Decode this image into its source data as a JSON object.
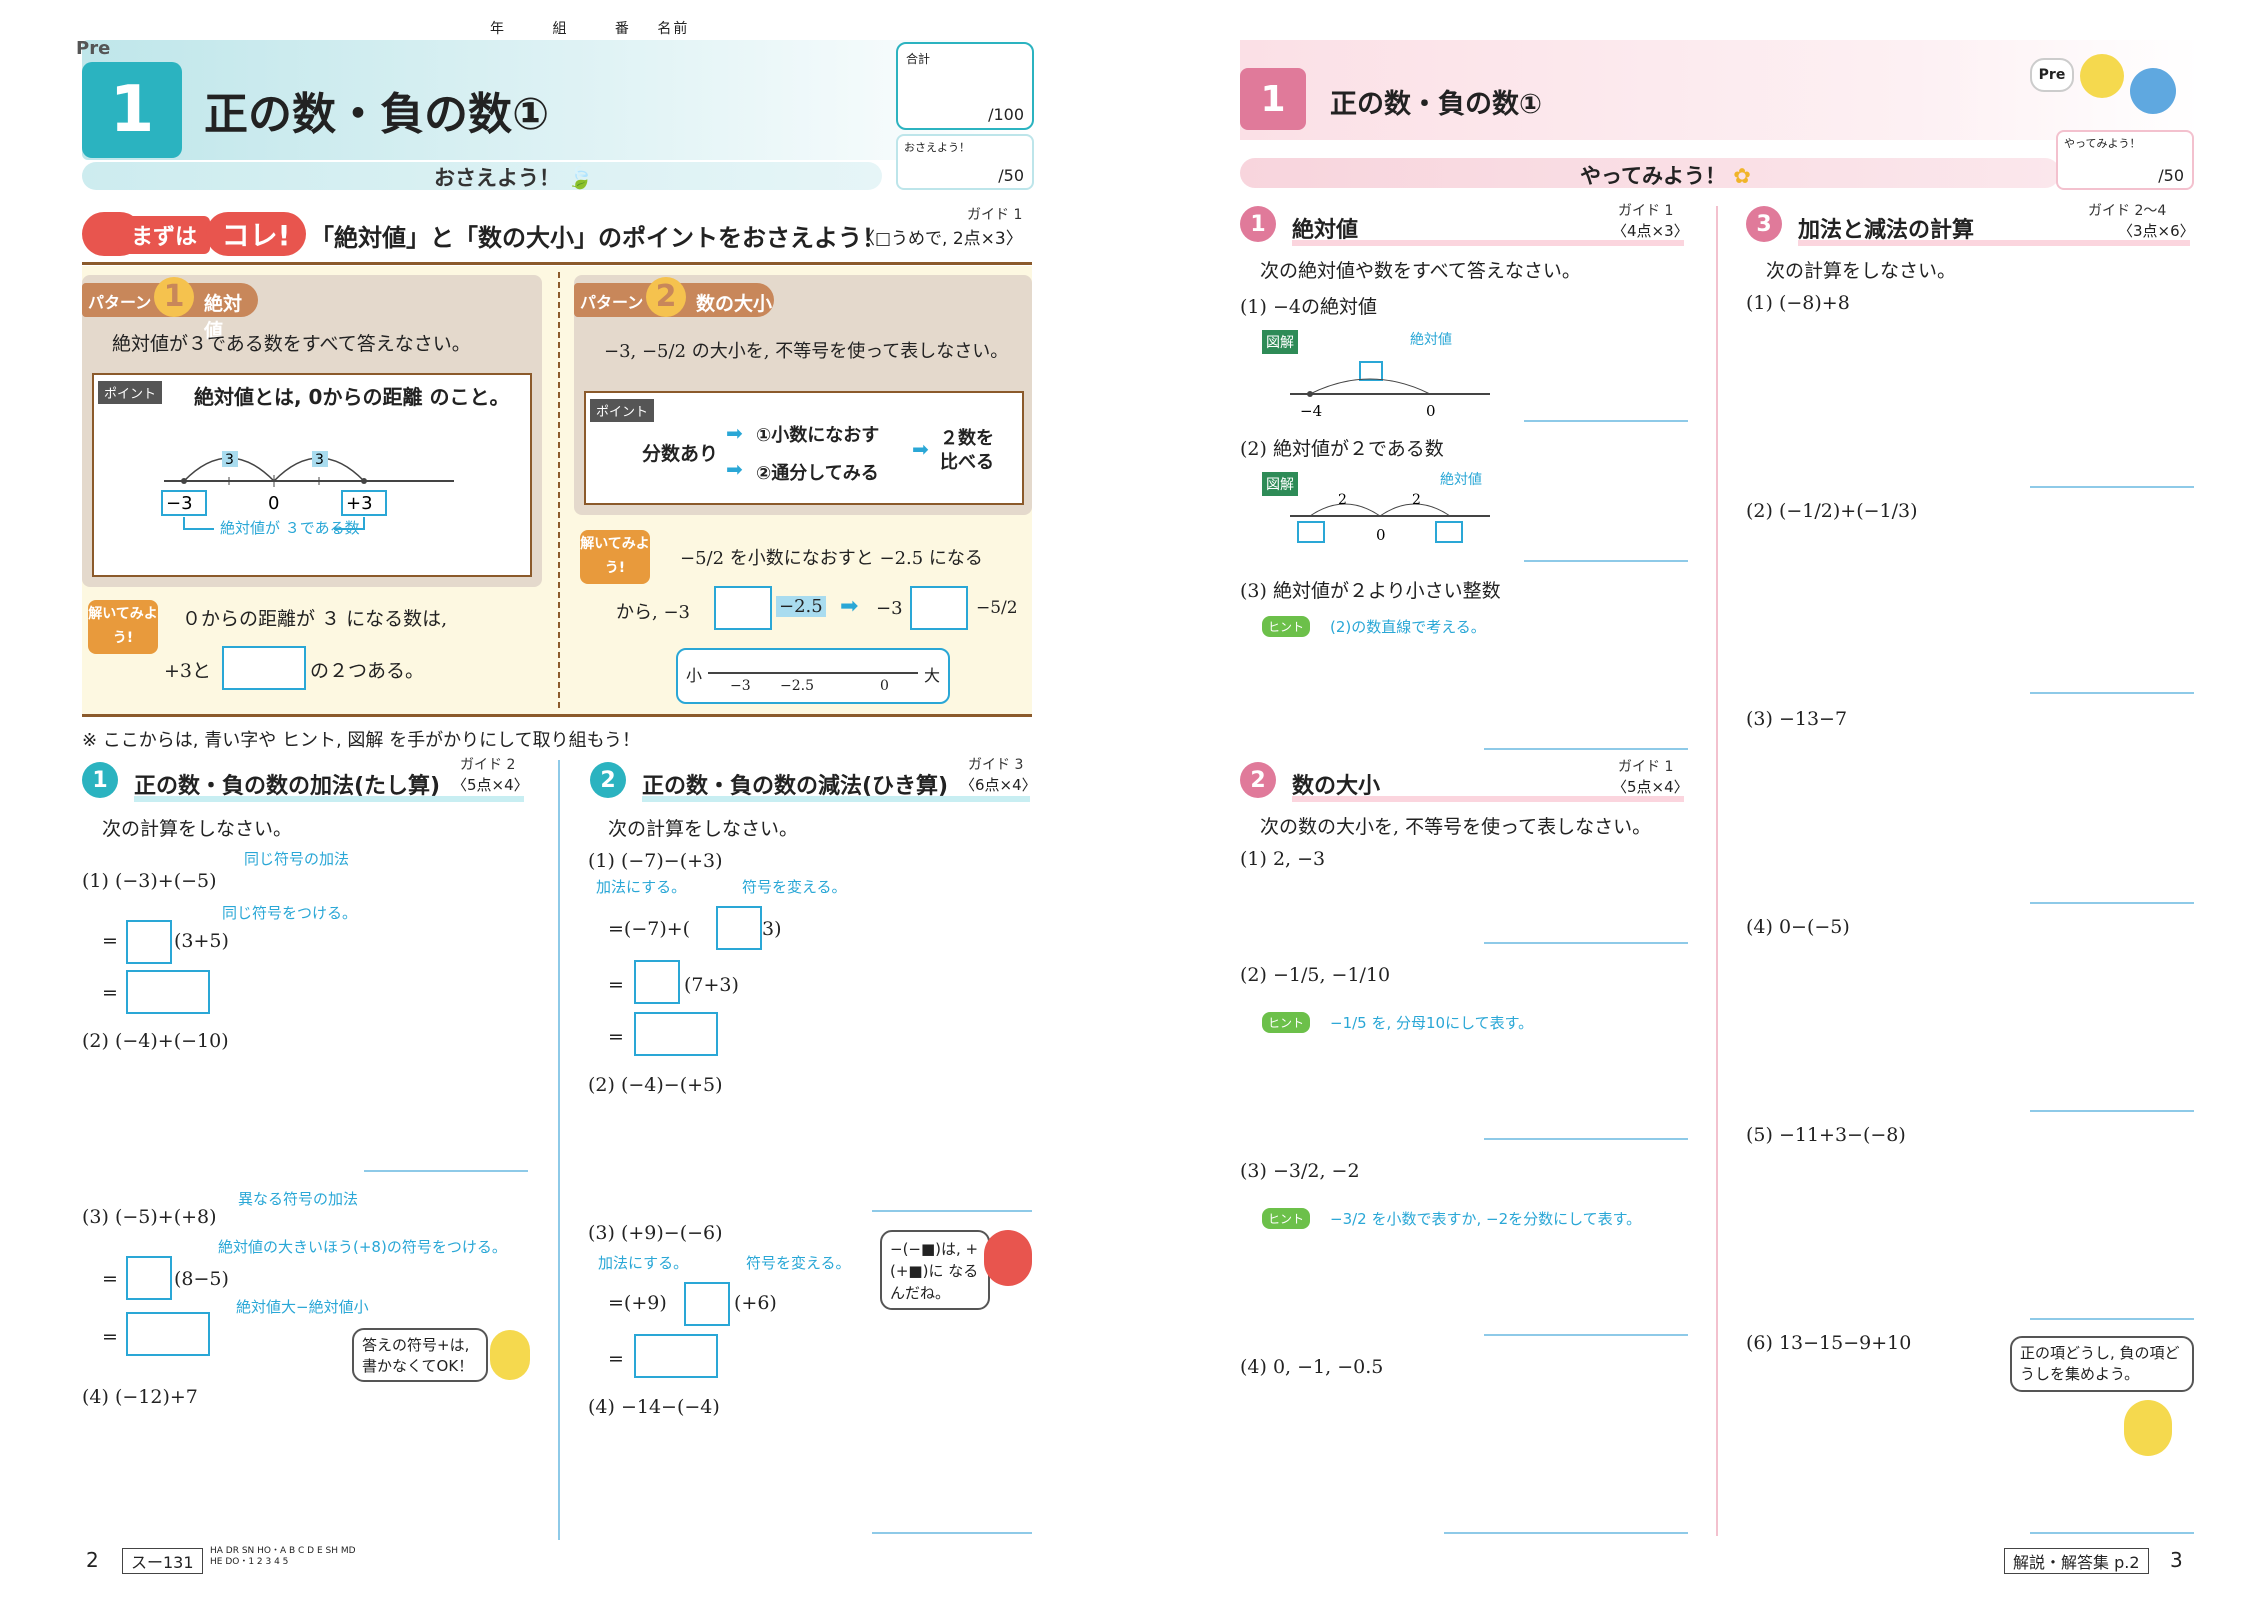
{
  "left": {
    "header": {
      "pre": "Pre",
      "name_fields": [
        "年",
        "組",
        "番",
        "名前"
      ],
      "unit_number": "1",
      "title": "正の数・負の数①",
      "osaeyou": "おさえよう！",
      "score_total_label": "合計",
      "score_total": "/100",
      "score_osae_label": "おさえよう！",
      "score_osae": "/50"
    },
    "mazu": {
      "badge": "まずは",
      "kore": "コレ!",
      "text": "「絶対値」と「数の大小」のポイントをおさえよう！",
      "note": "〈□うめで, 2点×3〉",
      "guide": "ガイド 1"
    },
    "pattern1": {
      "label": "パターン",
      "num": "1",
      "title": "絶対値",
      "question": "絶対値が３である数をすべて答えなさい。",
      "point_label": "ポイント",
      "point_text": "絶対値とは, 0からの距離 のこと。",
      "diagram": {
        "left": "−3",
        "zero": "0",
        "right": "+3",
        "arc": "3",
        "caption": "絶対値が ３である数"
      },
      "toite_label": "解いてみよう!",
      "line1": "０からの距離が ３ になる数は,",
      "line2a": "+3と",
      "line2b": "の２つある。"
    },
    "pattern2": {
      "label": "パターン",
      "num": "2",
      "title": "数の大小",
      "question": "−3, −5/2 の大小を, 不等号を使って表しなさい。",
      "point_label": "ポイント",
      "bunsu": "分数あり",
      "opt1": "①小数になおす",
      "opt2": "②通分してみる",
      "result": "２数を比べる",
      "toite_label": "解いてみよう!",
      "line1": "−5/2 を小数になおすと −2.5 になる",
      "line2a": "から, −3",
      "line2b": "−2.5",
      "line2c": "−3",
      "line2d": "−5/2",
      "numline": {
        "small": "小",
        "big": "大",
        "a": "−3",
        "b": "−2.5",
        "c": "0"
      }
    },
    "note": "※ ここからは, 青い字や ヒント, 図解 を手がかりにして取り組もう！",
    "sec1": {
      "num": "1",
      "title": "正の数・負の数の加法(たし算)",
      "points": "〈5点×4〉",
      "guide": "ガイド 2",
      "instruction": "次の計算をしなさい。",
      "q1": "(1)  (−3)+(−5)",
      "q1_note1": "同じ符号の加法",
      "q1_note2": "同じ符号をつける。",
      "q1_step": "(3+5)",
      "q2": "(2)  (−4)+(−10)",
      "q3": "(3)  (−5)+(+8)",
      "q3_note1": "異なる符号の加法",
      "q3_note2": "絶対値の大きいほう(+8)の符号をつける。",
      "q3_step": "(8−5)",
      "q3_note3": "絶対値大−絶対値小",
      "bubble": "答えの符号+は, 書かなくてOK！",
      "q4": "(4)  (−12)+7"
    },
    "sec2": {
      "num": "2",
      "title": "正の数・負の数の減法(ひき算)",
      "points": "〈6点×4〉",
      "guide": "ガイド 3",
      "instruction": "次の計算をしなさい。",
      "q1": "(1)  (−7)−(+3)",
      "q1_note1": "加法にする。",
      "q1_note2": "符号を変える。",
      "q1_step1a": "=(−7)+(",
      "q1_step1b": "3)",
      "q1_step2": "(7+3)",
      "q2": "(2)  (−4)−(+5)",
      "q3": "(3)  (+9)−(−6)",
      "q3_note1": "加法にする。",
      "q3_note2": "符号を変える。",
      "q3_step1a": "=(+9)",
      "q3_step1b": "(+6)",
      "bubble": "−(−■)は, +(+■)に なるんだね。",
      "q4": "(4)  −14−(−4)"
    },
    "footer": {
      "page": "2",
      "code": "スー131",
      "tiny": "HA DR SN HO・A B C D E SH MD HE DO・1 2 3 4 5"
    }
  },
  "right": {
    "header": {
      "unit_number": "1",
      "title": "正の数・負の数①",
      "yattemiyou": "やってみよう！",
      "pre": "Pre",
      "score_label": "やってみよう！",
      "score": "/50"
    },
    "sec1": {
      "num": "1",
      "title": "絶対値",
      "points": "〈4点×3〉",
      "guide": "ガイド 1",
      "instruction": "次の絶対値や数をすべて答えなさい。",
      "q1": "(1)  −4の絶対値",
      "zukai": "図解",
      "d1_label": "絶対値",
      "d1_left": "−4",
      "d1_right": "0",
      "q2": "(2)  絶対値が２である数",
      "d2_label": "絶対値",
      "d2_zero": "0",
      "d2_arc": "2",
      "q3": "(3)  絶対値が２より小さい整数",
      "hint_label": "ヒント",
      "hint3": "(2)の数直線で考える。"
    },
    "sec2": {
      "num": "2",
      "title": "数の大小",
      "points": "〈5点×4〉",
      "guide": "ガイド 1",
      "instruction": "次の数の大小を, 不等号を使って表しなさい。",
      "q1": "(1)  2, −3",
      "q2": "(2)  −1/5, −1/10",
      "hint2": "−1/5 を, 分母10にして表す。",
      "q3": "(3)  −3/2, −2",
      "hint3": "−3/2 を小数で表すか, −2を分数にして表す。",
      "q4": "(4)  0, −1, −0.5"
    },
    "sec3": {
      "num": "3",
      "title": "加法と減法の計算",
      "points": "〈3点×6〉",
      "guide": "ガイド 2〜4",
      "instruction": "次の計算をしなさい。",
      "q1": "(1)  (−8)+8",
      "q2": "(2)  (−1/2)+(−1/3)",
      "q3": "(3)  −13−7",
      "q4": "(4)  0−(−5)",
      "q5": "(5)  −11+3−(−8)",
      "q6": "(6)  13−15−9+10",
      "bubble": "正の項どうし, 負の項どうしを集めよう。"
    },
    "footer": {
      "answers": "解説・解答集 p.2",
      "page": "3"
    }
  },
  "colors": {
    "teal": "#2bb3c0",
    "pink": "#e07a9a",
    "blue": "#2aa7d6",
    "cream": "#fdf8e1"
  }
}
